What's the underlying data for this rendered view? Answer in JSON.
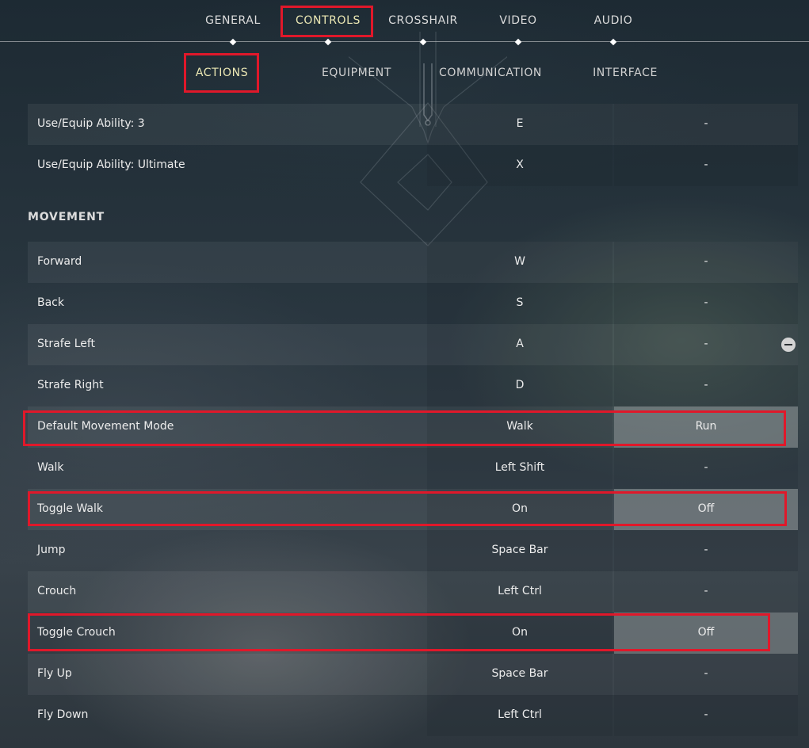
{
  "nav": {
    "tabs": [
      {
        "label": "GENERAL"
      },
      {
        "label": "CONTROLS"
      },
      {
        "label": "CROSSHAIR"
      },
      {
        "label": "VIDEO"
      },
      {
        "label": "AUDIO"
      }
    ],
    "active_tab": "CONTROLS"
  },
  "subnav": {
    "tabs": [
      {
        "label": "ACTIONS"
      },
      {
        "label": "EQUIPMENT"
      },
      {
        "label": "COMMUNICATION"
      },
      {
        "label": "INTERFACE"
      }
    ],
    "active_tab": "ACTIONS"
  },
  "ability_rows": [
    {
      "label": "Use/Equip Ability: 3",
      "primary": "E",
      "secondary": "-"
    },
    {
      "label": "Use/Equip Ability: Ultimate",
      "primary": "X",
      "secondary": "-"
    }
  ],
  "movement": {
    "title": "MOVEMENT",
    "rows": [
      {
        "label": "Forward",
        "primary": "W",
        "secondary": "-"
      },
      {
        "label": "Back",
        "primary": "S",
        "secondary": "-"
      },
      {
        "label": "Strafe Left",
        "primary": "A",
        "secondary": "-"
      },
      {
        "label": "Strafe Right",
        "primary": "D",
        "secondary": "-"
      },
      {
        "label": "Default Movement Mode",
        "primary": "Walk",
        "secondary": "Run"
      },
      {
        "label": "Walk",
        "primary": "Left Shift",
        "secondary": "-"
      },
      {
        "label": "Toggle Walk",
        "primary": "On",
        "secondary": "Off"
      },
      {
        "label": "Jump",
        "primary": "Space Bar",
        "secondary": "-"
      },
      {
        "label": "Crouch",
        "primary": "Left Ctrl",
        "secondary": "-"
      },
      {
        "label": "Toggle Crouch",
        "primary": "On",
        "secondary": "Off"
      },
      {
        "label": "Fly Up",
        "primary": "Space Bar",
        "secondary": "-"
      },
      {
        "label": "Fly Down",
        "primary": "Left Ctrl",
        "secondary": "-"
      }
    ]
  },
  "colors": {
    "highlight": "#e0182a",
    "active_tab_text": "#ece8b4"
  },
  "icons": {
    "unbind": "minus-circle-icon"
  }
}
